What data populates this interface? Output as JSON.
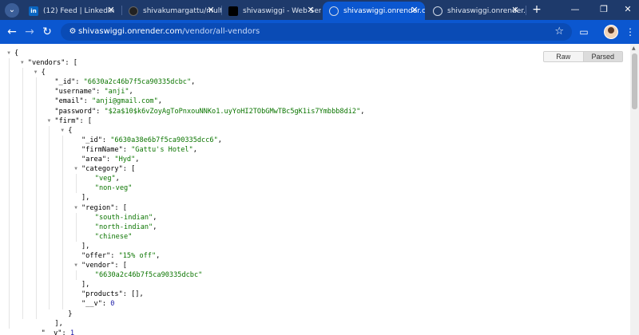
{
  "tabs": [
    {
      "title": "(12) Feed | LinkedIn",
      "favicon": "linkedin-icon",
      "active": false
    },
    {
      "title": "shivakumargattu/multi_v",
      "favicon": "github-icon",
      "active": false
    },
    {
      "title": "shivaswiggi - Web Servic",
      "favicon": "render-icon",
      "active": false
    },
    {
      "title": "shivaswiggi.onrender.com",
      "favicon": "globe-icon",
      "active": true
    },
    {
      "title": "shivaswiggi.onrender.com",
      "favicon": "globe-icon",
      "active": false
    }
  ],
  "linkedin_badge": "in",
  "address": {
    "host": "shivaswiggi.onrender.com",
    "path": "/vendor/all-vendors"
  },
  "viewer": {
    "raw_label": "Raw",
    "parsed_label": "Parsed",
    "selected": "Parsed"
  },
  "json_lines": [
    [
      {
        "t": "{",
        "c": "p"
      }
    ],
    [
      {
        "t": "\"vendors\"",
        "c": "k"
      },
      {
        "t": ": [",
        "c": "p"
      }
    ],
    [
      {
        "t": "{",
        "c": "p"
      }
    ],
    [
      {
        "t": "\"_id\"",
        "c": "k"
      },
      {
        "t": ": ",
        "c": "p"
      },
      {
        "t": "\"6630a2c46b7f5ca90335dcbc\"",
        "c": "s"
      },
      {
        "t": ",",
        "c": "p"
      }
    ],
    [
      {
        "t": "\"username\"",
        "c": "k"
      },
      {
        "t": ": ",
        "c": "p"
      },
      {
        "t": "\"anji\"",
        "c": "s"
      },
      {
        "t": ",",
        "c": "p"
      }
    ],
    [
      {
        "t": "\"email\"",
        "c": "k"
      },
      {
        "t": ": ",
        "c": "p"
      },
      {
        "t": "\"anji@gmail.com\"",
        "c": "s"
      },
      {
        "t": ",",
        "c": "p"
      }
    ],
    [
      {
        "t": "\"password\"",
        "c": "k"
      },
      {
        "t": ": ",
        "c": "p"
      },
      {
        "t": "\"$2a$10$k6vZoyAgToPnxouNNKo1.uyYoHI2TObGMwTBc5gK1is7Ymbbb8di2\"",
        "c": "s"
      },
      {
        "t": ",",
        "c": "p"
      }
    ],
    [
      {
        "t": "\"firm\"",
        "c": "k"
      },
      {
        "t": ": [",
        "c": "p"
      }
    ],
    [
      {
        "t": "{",
        "c": "p"
      }
    ],
    [
      {
        "t": "\"_id\"",
        "c": "k"
      },
      {
        "t": ": ",
        "c": "p"
      },
      {
        "t": "\"6630a38e6b7f5ca90335dcc6\"",
        "c": "s"
      },
      {
        "t": ",",
        "c": "p"
      }
    ],
    [
      {
        "t": "\"firmName\"",
        "c": "k"
      },
      {
        "t": ": ",
        "c": "p"
      },
      {
        "t": "\"Gattu's Hotel\"",
        "c": "s"
      },
      {
        "t": ",",
        "c": "p"
      }
    ],
    [
      {
        "t": "\"area\"",
        "c": "k"
      },
      {
        "t": ": ",
        "c": "p"
      },
      {
        "t": "\"Hyd\"",
        "c": "s"
      },
      {
        "t": ",",
        "c": "p"
      }
    ],
    [
      {
        "t": "\"category\"",
        "c": "k"
      },
      {
        "t": ": [",
        "c": "p"
      }
    ],
    [
      {
        "t": "\"veg\"",
        "c": "s"
      },
      {
        "t": ",",
        "c": "p"
      }
    ],
    [
      {
        "t": "\"non-veg\"",
        "c": "s"
      }
    ],
    [
      {
        "t": "],",
        "c": "p"
      }
    ],
    [
      {
        "t": "\"region\"",
        "c": "k"
      },
      {
        "t": ": [",
        "c": "p"
      }
    ],
    [
      {
        "t": "\"south-indian\"",
        "c": "s"
      },
      {
        "t": ",",
        "c": "p"
      }
    ],
    [
      {
        "t": "\"north-indian\"",
        "c": "s"
      },
      {
        "t": ",",
        "c": "p"
      }
    ],
    [
      {
        "t": "\"chinese\"",
        "c": "s"
      }
    ],
    [
      {
        "t": "],",
        "c": "p"
      }
    ],
    [
      {
        "t": "\"offer\"",
        "c": "k"
      },
      {
        "t": ": ",
        "c": "p"
      },
      {
        "t": "\"15% off\"",
        "c": "s"
      },
      {
        "t": ",",
        "c": "p"
      }
    ],
    [
      {
        "t": "\"vendor\"",
        "c": "k"
      },
      {
        "t": ": [",
        "c": "p"
      }
    ],
    [
      {
        "t": "\"6630a2c46b7f5ca90335dcbc\"",
        "c": "s"
      }
    ],
    [
      {
        "t": "],",
        "c": "p"
      }
    ],
    [
      {
        "t": "\"products\"",
        "c": "k"
      },
      {
        "t": ": [],",
        "c": "p"
      }
    ],
    [
      {
        "t": "\"__v\"",
        "c": "k"
      },
      {
        "t": ": ",
        "c": "p"
      },
      {
        "t": "0",
        "c": "n"
      }
    ],
    [
      {
        "t": "}",
        "c": "p"
      }
    ],
    [
      {
        "t": "],",
        "c": "p"
      }
    ],
    [
      {
        "t": "\"__v\"",
        "c": "k"
      },
      {
        "t": ": ",
        "c": "p"
      },
      {
        "t": "1",
        "c": "n"
      }
    ]
  ],
  "colors": {
    "tabstrip": "#1e3a6b",
    "toolbar": "#0b57d0",
    "json_string": "#0b7500",
    "json_number": "#1a1aa6"
  }
}
